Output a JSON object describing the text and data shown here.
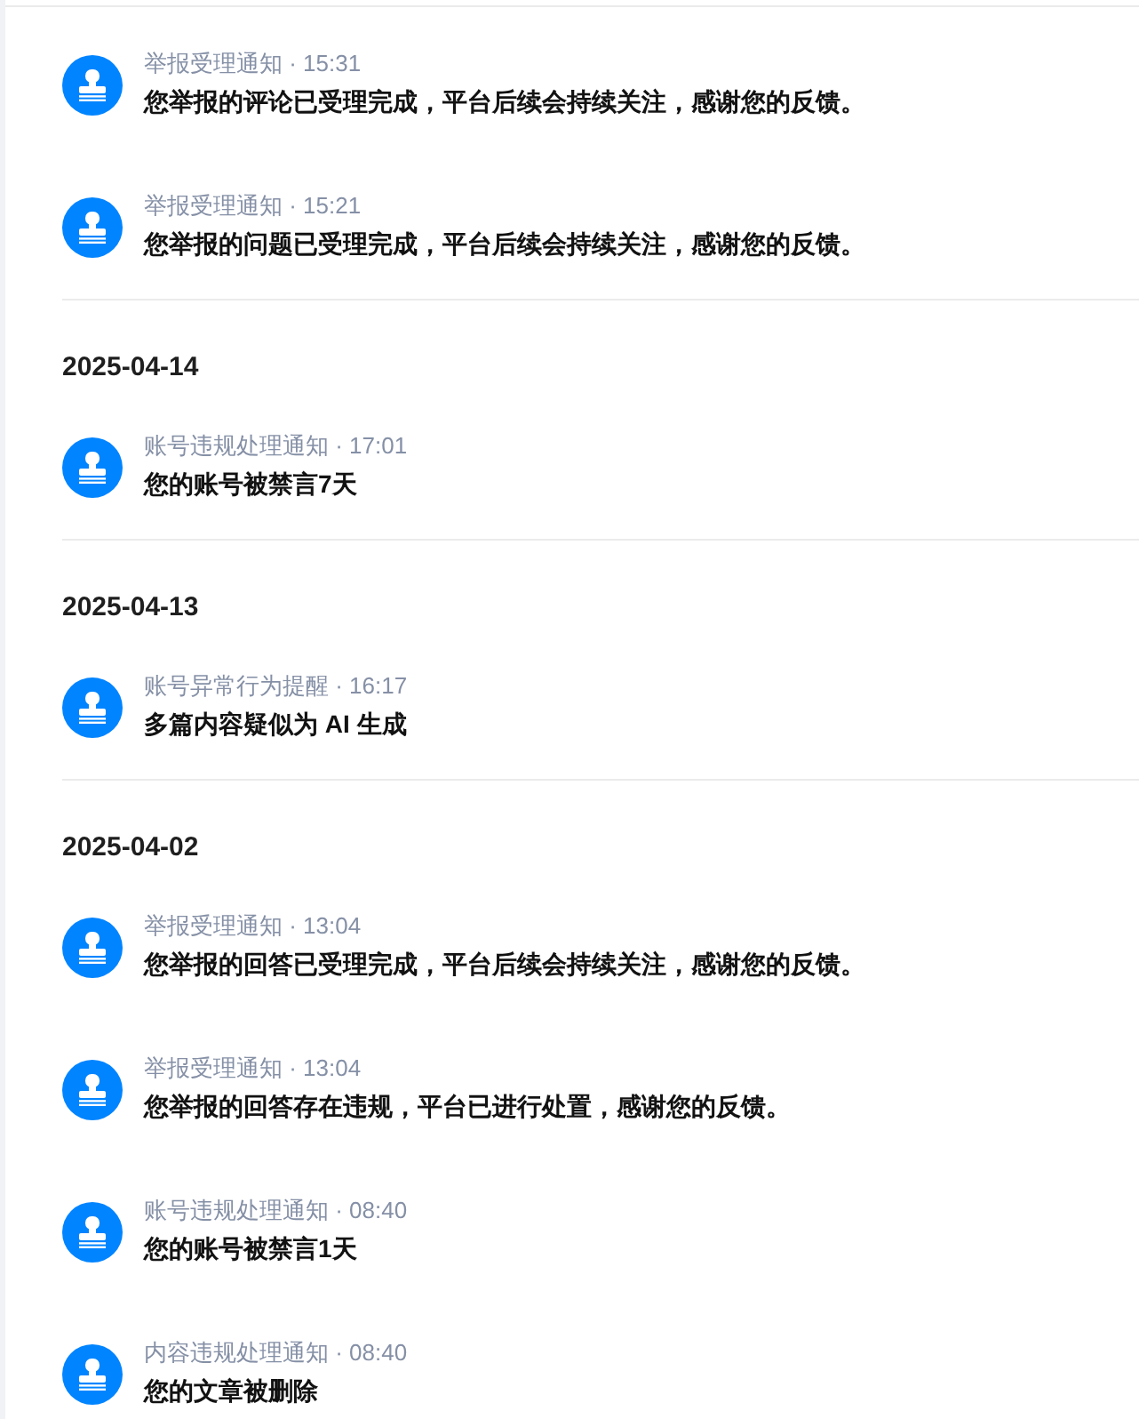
{
  "groups": [
    {
      "items": [
        {
          "title": "举报受理通知 · 15:31",
          "message": "您举报的评论已受理完成，平台后续会持续关注，感谢您的反馈。"
        },
        {
          "title": "举报受理通知 · 15:21",
          "message": "您举报的问题已受理完成，平台后续会持续关注，感谢您的反馈。"
        }
      ]
    },
    {
      "date": "2025-04-14",
      "items": [
        {
          "title": "账号违规处理通知 · 17:01",
          "message": "您的账号被禁言7天"
        }
      ]
    },
    {
      "date": "2025-04-13",
      "items": [
        {
          "title": "账号异常行为提醒 · 16:17",
          "message": "多篇内容疑似为 AI 生成"
        }
      ]
    },
    {
      "date": "2025-04-02",
      "items": [
        {
          "title": "举报受理通知 · 13:04",
          "message": "您举报的回答已受理完成，平台后续会持续关注，感谢您的反馈。"
        },
        {
          "title": "举报受理通知 · 13:04",
          "message": "您举报的回答存在违规，平台已进行处置，感谢您的反馈。"
        },
        {
          "title": "账号违规处理通知 · 08:40",
          "message": "您的账号被禁言1天"
        },
        {
          "title": "内容违规处理通知 · 08:40",
          "message": "您的文章被删除"
        }
      ]
    }
  ]
}
